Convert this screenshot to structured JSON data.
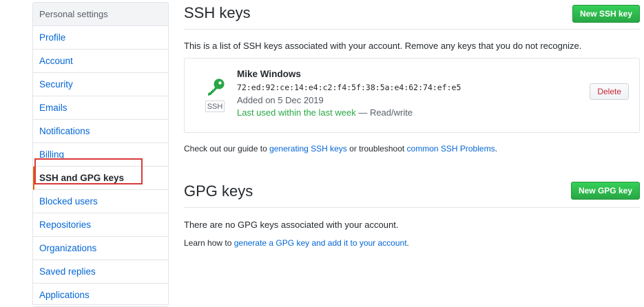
{
  "sidebar": {
    "header": "Personal settings",
    "items": [
      {
        "label": "Profile"
      },
      {
        "label": "Account"
      },
      {
        "label": "Security"
      },
      {
        "label": "Emails"
      },
      {
        "label": "Notifications"
      },
      {
        "label": "Billing"
      },
      {
        "label": "SSH and GPG keys"
      },
      {
        "label": "Blocked users"
      },
      {
        "label": "Repositories"
      },
      {
        "label": "Organizations"
      },
      {
        "label": "Saved replies"
      },
      {
        "label": "Applications"
      }
    ]
  },
  "ssh": {
    "title": "SSH keys",
    "new_button": "New SSH key",
    "description": "This is a list of SSH keys associated with your account. Remove any keys that you do not recognize.",
    "key": {
      "name": "Mike Windows",
      "fingerprint": "72:ed:92:ce:14:e4:c2:f4:5f:38:5a:e4:62:74:ef:e5",
      "type_badge": "SSH",
      "added": "Added on 5 Dec 2019",
      "last_used": "Last used within the last week",
      "access": " — Read/write",
      "delete_button": "Delete",
      "icon": "key-icon"
    },
    "guide_prefix": "Check out our guide to ",
    "guide_link": "generating SSH keys",
    "guide_middle": " or troubleshoot ",
    "guide_link2": "common SSH Problems",
    "guide_suffix": "."
  },
  "gpg": {
    "title": "GPG keys",
    "new_button": "New GPG key",
    "empty_text": "There are no GPG keys associated with your account.",
    "learn_prefix": "Learn how to ",
    "learn_link": "generate a GPG key and add it to your account",
    "learn_suffix": "."
  },
  "colors": {
    "accent_green": "#28a745",
    "link_blue": "#0366d6",
    "danger_red": "#cb2431",
    "highlight_red": "#d93a3a"
  }
}
